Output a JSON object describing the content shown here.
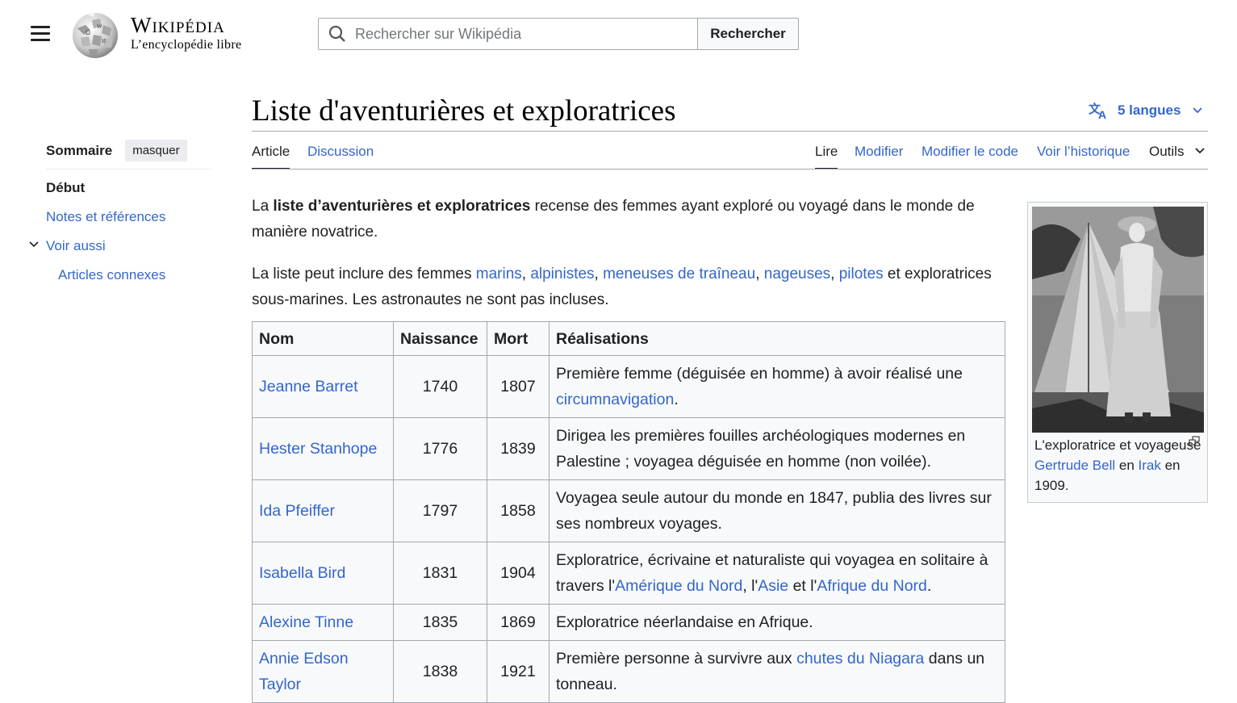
{
  "header": {
    "wordmark_title": "Wikipédia",
    "wordmark_tagline": "L’encyclopédie libre",
    "search_placeholder": "Rechercher sur Wikipédia",
    "search_button": "Rechercher"
  },
  "toc": {
    "title": "Sommaire",
    "hide_label": "masquer",
    "items": [
      {
        "label": "Début"
      },
      {
        "label": "Notes et références"
      },
      {
        "label": "Voir aussi"
      },
      {
        "label": "Articles connexes"
      }
    ]
  },
  "page": {
    "title": "Liste d'aventurières et exploratrices",
    "languages": "5 langues"
  },
  "tabs": {
    "article": "Article",
    "discussion": "Discussion",
    "read": "Lire",
    "edit": "Modifier",
    "edit_source": "Modifier le code",
    "history": "Voir l’historique",
    "tools": "Outils"
  },
  "intro": {
    "p1_pre": "La ",
    "p1_bold": "liste d’aventurières et exploratrices",
    "p1_post": " recense des femmes ayant exploré ou voyagé dans le monde de manière novatrice.",
    "p2_pre": "La liste peut inclure des femmes ",
    "link_marins": "marins",
    "link_alpinistes": "alpinistes",
    "link_traineau": "meneuses de traîneau",
    "link_nageuses": "nageuses",
    "link_pilotes": "pilotes",
    "p2_post": " et exploratrices sous-marines. Les astronautes ne sont pas incluses.",
    "comma": ", ",
    "comma2": ", ",
    "comma3": ", ",
    "comma4": ", "
  },
  "table": {
    "headers": {
      "name": "Nom",
      "birth": "Naissance",
      "death": "Mort",
      "achievements": "Réalisations"
    },
    "rows": [
      {
        "name": "Jeanne Barret",
        "birth": "1740",
        "death": "1807",
        "text_pre": "Première femme (déguisée en homme) à avoir réalisé une ",
        "link": "circumnavigation",
        "text_post": "."
      },
      {
        "name": "Hester Stanhope",
        "birth": "1776",
        "death": "1839",
        "text": "Dirigea les premières fouilles archéologiques modernes en Palestine ; voyagea déguisée en homme (non voilée)."
      },
      {
        "name": "Ida Pfeiffer",
        "birth": "1797",
        "death": "1858",
        "text": "Voyagea seule autour du monde en 1847, publia des livres sur ses nombreux voyages."
      },
      {
        "name": "Isabella Bird",
        "birth": "1831",
        "death": "1904",
        "text_pre": "Exploratrice, écrivaine et naturaliste qui voyagea en solitaire à travers l'",
        "link1": "Amérique du Nord",
        "mid1": ", l'",
        "link2": "Asie",
        "mid2": " et l'",
        "link3": "Afrique du Nord",
        "text_post": "."
      },
      {
        "name": "Alexine Tinne",
        "birth": "1835",
        "death": "1869",
        "text": "Exploratrice néerlandaise en Afrique."
      },
      {
        "name": "Annie Edson Taylor",
        "birth": "1838",
        "death": "1921",
        "text_pre": "Première personne à survivre aux ",
        "link": "chutes du Niagara",
        "text_post": " dans un tonneau."
      }
    ]
  },
  "thumb": {
    "caption_pre": "L'exploratrice et voyageuse ",
    "link1": "Gertrude Bell",
    "caption_mid": " en ",
    "link2": "Irak",
    "caption_post": " en 1909."
  },
  "icons": [
    "menu-icon",
    "wikipedia-globe-logo",
    "search-icon",
    "translate-icon",
    "chevron-down-icon",
    "magnify-icon"
  ],
  "colors": {
    "link": "#3366cc",
    "text": "#202122",
    "border": "#a2a9b1"
  }
}
